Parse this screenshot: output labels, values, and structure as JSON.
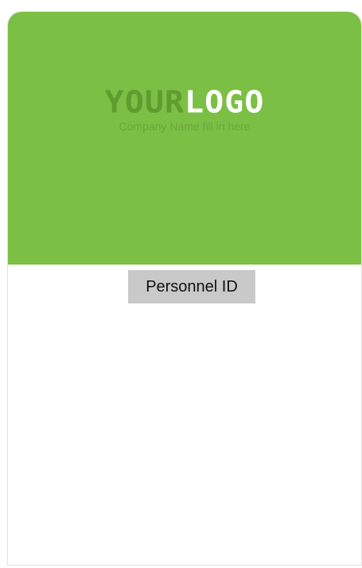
{
  "colors": {
    "brand": "#7bbf44",
    "logo_dark": "#5f9c2f",
    "tagline": "#6aa83a",
    "label_background": "#c9c9c9"
  },
  "logo": {
    "word_part1": "YOUR",
    "word_part2": "LOGO",
    "tagline": "Company Name fill in here"
  },
  "card": {
    "label": "Personnel ID"
  }
}
